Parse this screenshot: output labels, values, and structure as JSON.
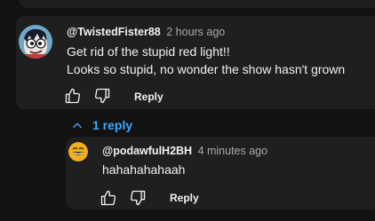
{
  "comment": {
    "author": "@TwistedFister88",
    "time": "2 hours ago",
    "lines": [
      "Get rid of the stupid red light!!",
      "Looks so stupid,  no wonder the show hasn't grown"
    ],
    "reply_label": "Reply",
    "replies_toggle_label": "1 reply"
  },
  "reply": {
    "author": "@podawfulH2BH",
    "time": "4 minutes ago",
    "text": "hahahahahaah",
    "reply_label": "Reply"
  },
  "icons": {
    "like": "thumbs-up-icon",
    "dislike": "thumbs-down-icon",
    "collapse": "chevron-up-icon"
  },
  "colors": {
    "background": "#121212",
    "card": "#1f1f1f",
    "link": "#3ea6ff",
    "muted": "#aaaaaa"
  }
}
